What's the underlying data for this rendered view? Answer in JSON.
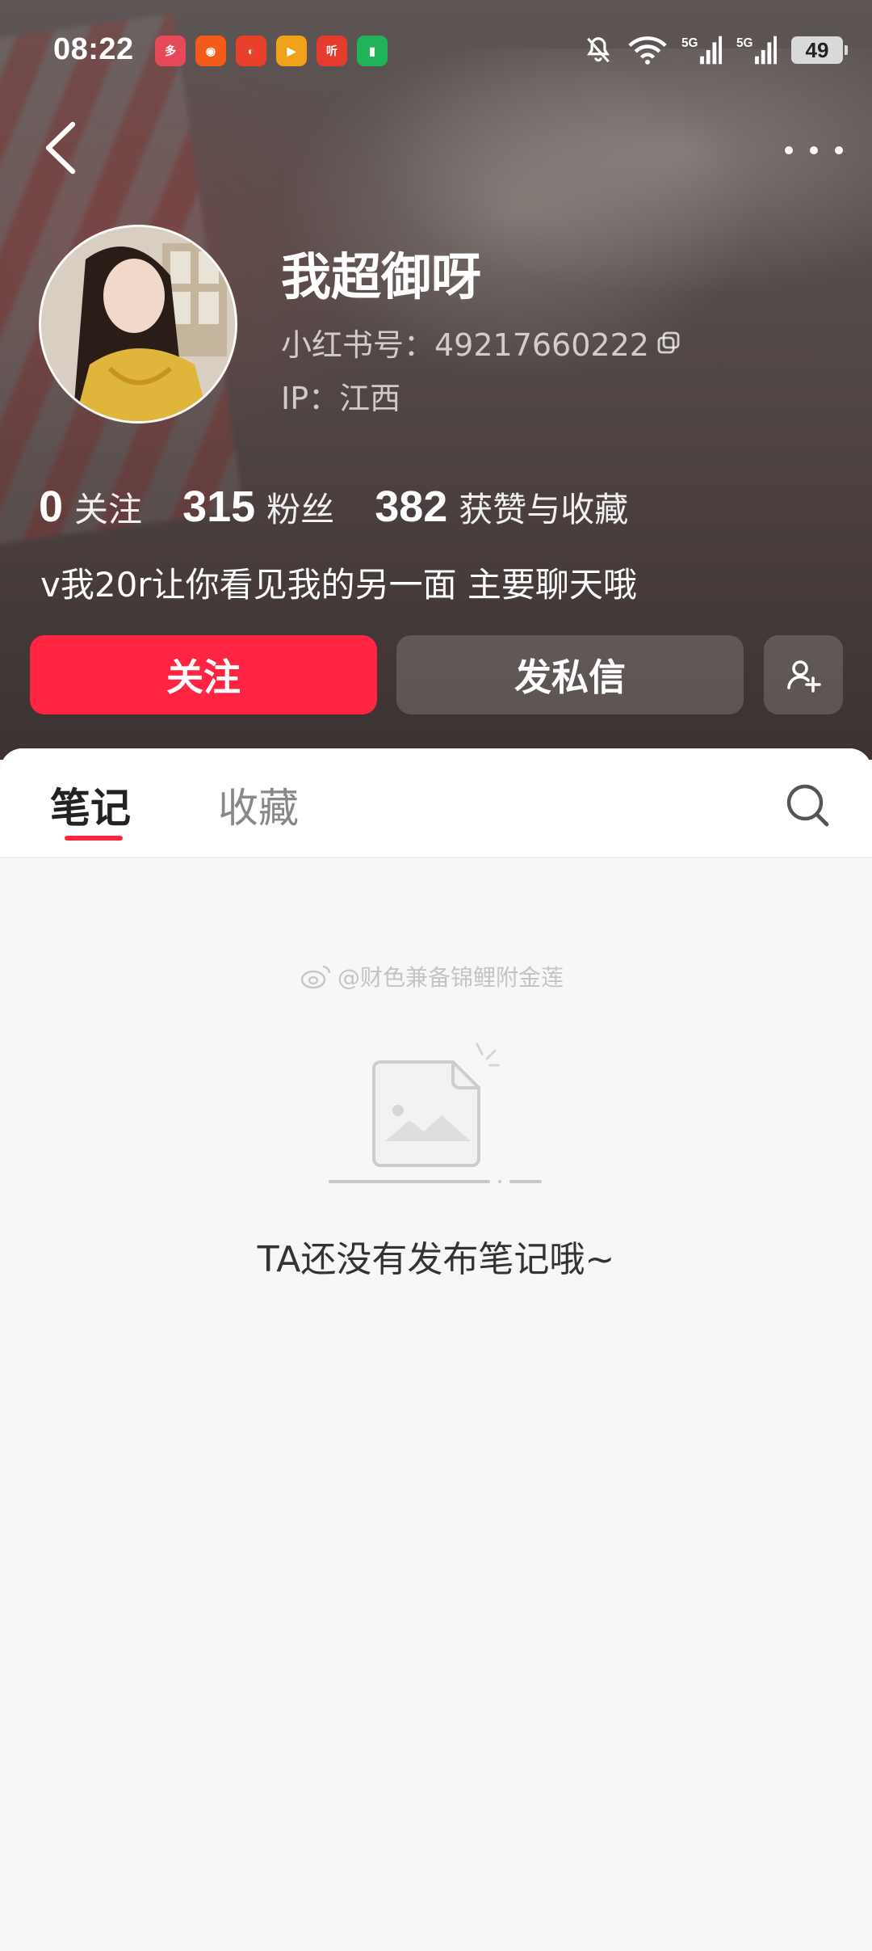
{
  "status_bar": {
    "time": "08:22",
    "app_icons": [
      {
        "name": "app-icon-1",
        "color": "#e64a5a",
        "glyph": "多"
      },
      {
        "name": "app-icon-2",
        "color": "#f25b1a",
        "glyph": "◉"
      },
      {
        "name": "app-icon-3",
        "color": "#e8402a",
        "glyph": "◐"
      },
      {
        "name": "app-icon-4",
        "color": "#f0a21a",
        "glyph": "▶"
      },
      {
        "name": "app-icon-5",
        "color": "#e43c2c",
        "glyph": "听"
      },
      {
        "name": "app-icon-6",
        "color": "#21b35a",
        "glyph": "▮"
      }
    ],
    "battery": "49"
  },
  "profile": {
    "username": "我超御呀",
    "redbook_id": "小红书号：49217660222",
    "ip": "IP：江西",
    "stats": [
      {
        "num": "0",
        "label": "关注"
      },
      {
        "num": "315",
        "label": "粉丝"
      },
      {
        "num": "382",
        "label": "获赞与收藏"
      }
    ],
    "bio": "v我20r让你看见我的另一面 主要聊天哦"
  },
  "actions": {
    "follow": "关注",
    "message": "发私信"
  },
  "tabs": {
    "notes": "笔记",
    "collect": "收藏"
  },
  "watermark": "@财色兼备锦鲤附金莲",
  "empty_text": "TA还没有发布笔记哦~",
  "colors": {
    "accent": "#ff2442"
  }
}
